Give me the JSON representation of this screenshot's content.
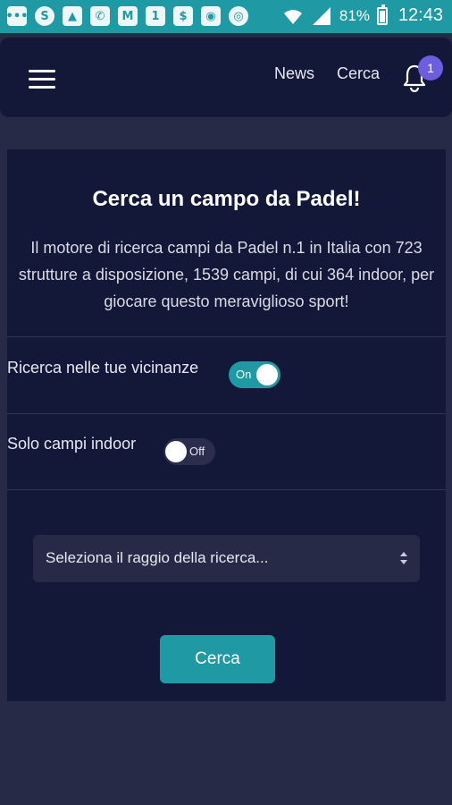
{
  "status_bar": {
    "notification_icons": [
      {
        "icon": "chat-bubble-icon",
        "glyph": "•••"
      },
      {
        "icon": "skype-icon",
        "glyph": "S"
      },
      {
        "icon": "image-icon",
        "glyph": "▲"
      },
      {
        "icon": "missed-call-icon",
        "glyph": "✆"
      },
      {
        "icon": "mail-icon",
        "glyph": "M"
      },
      {
        "icon": "calendar-icon",
        "glyph": "1"
      },
      {
        "icon": "dollar-app-icon",
        "glyph": "$"
      },
      {
        "icon": "android-icon",
        "glyph": "◉"
      },
      {
        "icon": "chrome-icon",
        "glyph": "◎"
      }
    ],
    "battery": "81%",
    "time": "12:43"
  },
  "header": {
    "nav_news": "News",
    "nav_cerca": "Cerca",
    "notifications_count": "1"
  },
  "card": {
    "title": "Cerca un campo da Padel!",
    "description": "Il motore di ricerca campi da Padel n.1 in Italia con 723 strutture a disposizione, 1539 campi, di cui 364 indoor, per giocare questo meraviglioso sport!",
    "nearby": {
      "label": "Ricerca nelle tue vicinanze",
      "toggle_text": "On",
      "state": "on"
    },
    "indoor": {
      "label": "Solo campi indoor",
      "toggle_text": "Off",
      "state": "off"
    },
    "radius_select": {
      "selected": "Seleziona il raggio della ricerca..."
    },
    "search_button": "Cerca"
  },
  "colors": {
    "accent": "#1f9aa5",
    "background": "#262a46",
    "card": "#141838",
    "badge": "#6d5ee0"
  }
}
